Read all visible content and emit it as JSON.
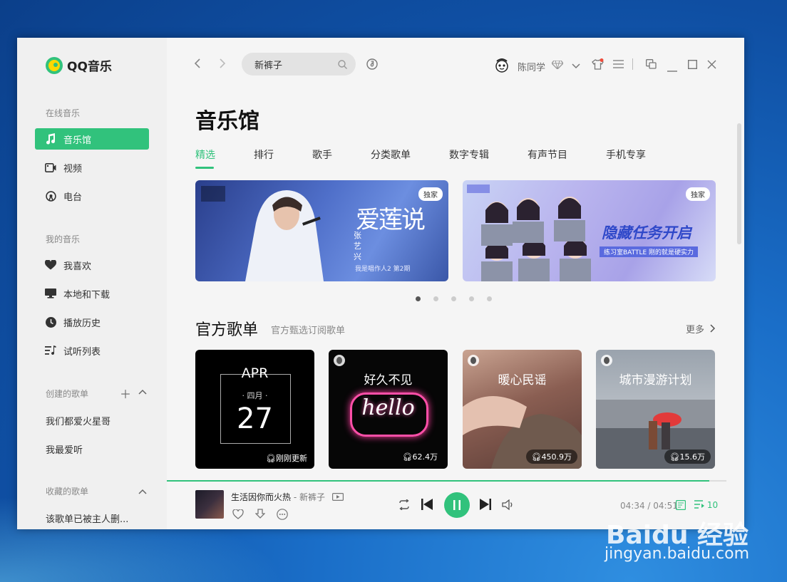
{
  "app": {
    "name": "QQ音乐",
    "accent": "#31c27c"
  },
  "sidebar": {
    "online_label": "在线音乐",
    "online_items": [
      {
        "label": "音乐馆",
        "icon": "music-note-icon",
        "active": true
      },
      {
        "label": "视频",
        "icon": "video-icon"
      },
      {
        "label": "电台",
        "icon": "radio-icon"
      }
    ],
    "my_label": "我的音乐",
    "my_items": [
      {
        "label": "我喜欢",
        "icon": "heart-icon"
      },
      {
        "label": "本地和下载",
        "icon": "monitor-icon"
      },
      {
        "label": "播放历史",
        "icon": "clock-icon"
      },
      {
        "label": "试听列表",
        "icon": "playlist-icon"
      }
    ],
    "created_label": "创建的歌单",
    "created_lists": [
      "我们都爱火星哥",
      "我最爱听"
    ],
    "collected_label": "收藏的歌单",
    "collected_lists": [
      "该歌单已被主人删..."
    ]
  },
  "topbar": {
    "search_value": "新裤子",
    "username": "陈同学"
  },
  "main": {
    "page_title": "音乐馆",
    "tabs": [
      "精选",
      "排行",
      "歌手",
      "分类歌单",
      "数字专辑",
      "有声节目",
      "手机专享"
    ],
    "banners": [
      {
        "badge": "独家",
        "title": "爱莲说",
        "artist": "张艺兴",
        "sub": "我是唱作人2 第2期"
      },
      {
        "badge": "独家",
        "title": "隐藏任务开启",
        "sub": "练习室BATTLE 刚的就是硬实力"
      }
    ],
    "section_title": "官方歌单",
    "section_sub": "官方甄选订阅歌单",
    "more_label": "更多",
    "cards": [
      {
        "month": "APR",
        "sub": "· 四月 ·",
        "day": "27",
        "plays": "刚刚更新"
      },
      {
        "title": "好久不见",
        "neon": "hello",
        "plays": "62.4万"
      },
      {
        "title": "暖心民谣",
        "plays": "450.9万"
      },
      {
        "title": "城市漫游计划",
        "plays": "15.6万"
      }
    ]
  },
  "player": {
    "song": "生活因你而火热",
    "artist": "新裤子",
    "time": "04:34 / 04:51",
    "queue_count": "10",
    "progress": 0.97
  },
  "watermark": {
    "brand": "Baidu 经验",
    "url": "jingyan.baidu.com"
  }
}
